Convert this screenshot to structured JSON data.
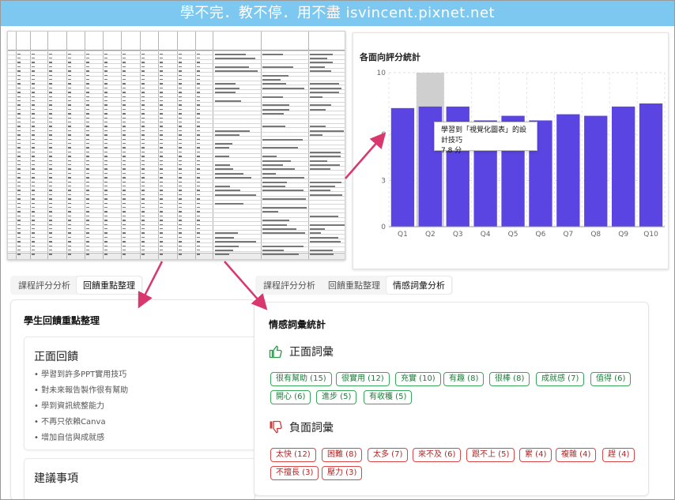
{
  "banner": {
    "text": "學不完．教不停．用不盡 isvincent.pixnet.net"
  },
  "chart": {
    "title": "各面向評分統計",
    "tooltip": {
      "label": "學習到「視覺化圖表」的設計技巧",
      "value": "7.8 分"
    }
  },
  "chart_data": {
    "type": "bar",
    "categories": [
      "Q1",
      "Q2",
      "Q3",
      "Q4",
      "Q5",
      "Q6",
      "Q7",
      "Q8",
      "Q9",
      "Q10"
    ],
    "values": [
      7.7,
      7.8,
      7.8,
      6.9,
      7.2,
      6.9,
      7.3,
      7.2,
      7.8,
      8.0
    ],
    "highlighted_category": "Q2",
    "ylim": [
      0,
      10
    ],
    "yticks": [
      "0",
      "3",
      "6",
      "10"
    ],
    "colors": {
      "bar": "#5b45e2",
      "highlight": "#cfcfcf"
    }
  },
  "tabs_left": {
    "items": [
      "課程評分分析",
      "回饋重點整理"
    ],
    "active": 1
  },
  "tabs_right": {
    "items": [
      "課程評分分析",
      "回饋重點整理",
      "情感詞彙分析"
    ],
    "active": 2
  },
  "feedback": {
    "title": "學生回饋重點整理",
    "positive": {
      "title": "正面回饋",
      "items": [
        "• 學習到許多PPT實用技巧",
        "• 對未來報告製作很有幫助",
        "• 學到資訊統整能力",
        "• 不再只依賴Canva",
        "• 增加自信與成就感"
      ]
    },
    "suggestions": {
      "title": "建議事項"
    }
  },
  "emotion": {
    "title": "情感詞彙統計",
    "positive": {
      "label": "正面詞彙",
      "icon": "thumbs-up-icon",
      "color": "#2e9a4b",
      "chips": [
        "很有幫助 (15)",
        "很實用 (12)",
        "充實 (10)",
        "有趣 (8)",
        "很棒 (8)",
        "成就感 (7)",
        "值得 (6)",
        "開心 (6)",
        "進步 (5)",
        "有收穫 (5)"
      ]
    },
    "negative": {
      "label": "負面詞彙",
      "icon": "thumbs-down-icon",
      "color": "#d23a3a",
      "chips": [
        "太快 (12)",
        "困難 (8)",
        "太多 (7)",
        "來不及 (6)",
        "跟不上 (5)",
        "累 (4)",
        "複雜 (4)",
        "趕 (4)",
        "不擅長 (3)",
        "壓力 (3)"
      ]
    }
  },
  "annotation": {
    "arrow_color": "#d9386f"
  }
}
